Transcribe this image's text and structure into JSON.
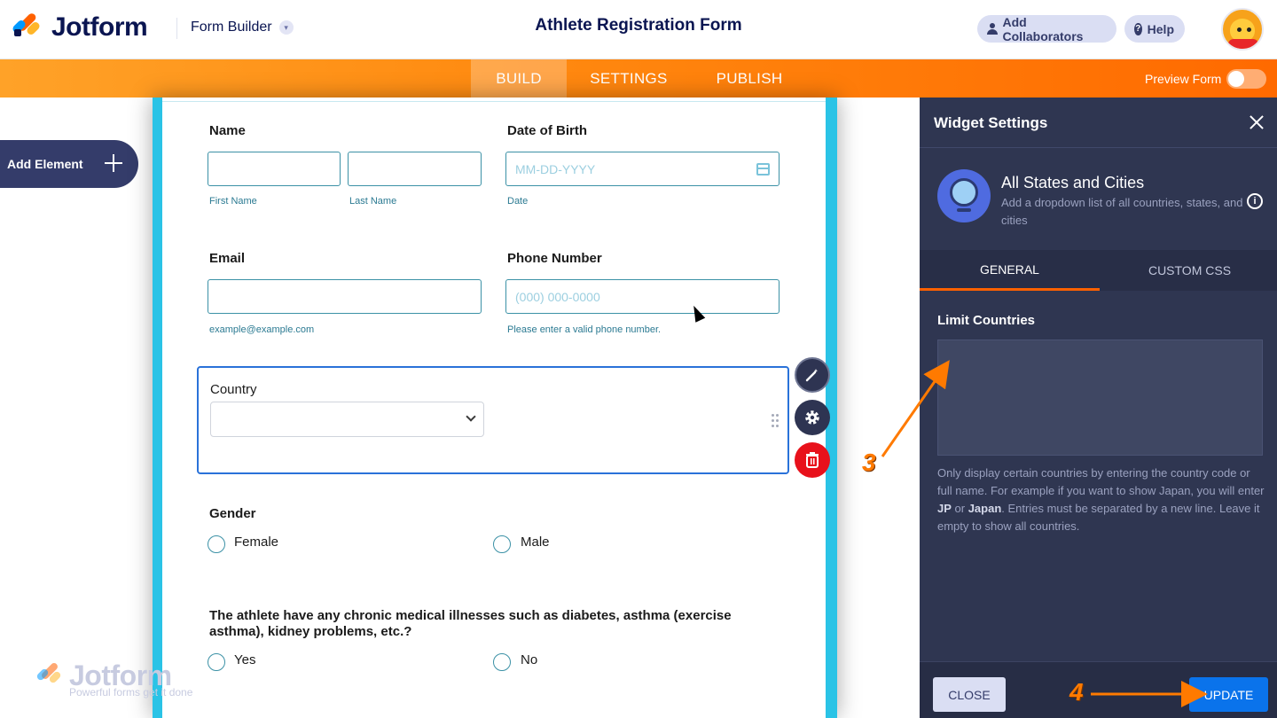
{
  "header": {
    "logo_text": "Jotform",
    "builder_label": "Form Builder",
    "form_title": "Athlete Registration Form",
    "add_collaborators": "Add Collaborators",
    "help": "Help"
  },
  "nav": {
    "tabs": [
      "BUILD",
      "SETTINGS",
      "PUBLISH"
    ],
    "active_tab": "BUILD",
    "preview_label": "Preview Form",
    "preview_enabled": false
  },
  "sidebar": {
    "add_element": "Add Element"
  },
  "form": {
    "name_label": "Name",
    "first_name_sub": "First Name",
    "last_name_sub": "Last Name",
    "dob_label": "Date of Birth",
    "dob_placeholder": "MM-DD-YYYY",
    "dob_sub": "Date",
    "email_label": "Email",
    "email_sub": "example@example.com",
    "phone_label": "Phone Number",
    "phone_placeholder": "(000) 000-0000",
    "phone_sub": "Please enter a valid phone number.",
    "country_label": "Country",
    "gender_label": "Gender",
    "gender_options": [
      "Female",
      "Male"
    ],
    "question": "The athlete have any chronic medical illnesses such as diabetes, asthma (exercise asthma), kidney problems, etc.?",
    "question_options": [
      "Yes",
      "No"
    ]
  },
  "watermark": {
    "text": "Jotform",
    "tagline": "Powerful forms get it done"
  },
  "panel": {
    "title": "Widget Settings",
    "widget_name": "All States and Cities",
    "widget_desc": "Add a dropdown list of all countries, states, and cities",
    "tabs": [
      "GENERAL",
      "CUSTOM CSS"
    ],
    "active_tab": "GENERAL",
    "field_label": "Limit Countries",
    "field_value": "",
    "help_part1": "Only display certain countries by entering the country code or full name. For example if you want to show Japan, you will enter ",
    "help_bold1": "JP",
    "help_or": " or ",
    "help_bold2": "Japan",
    "help_part2": ". Entries must be separated by a new line. Leave it empty to show all countries.",
    "close_button": "CLOSE",
    "update_button": "UPDATE"
  },
  "annotations": {
    "step3": "3",
    "step4": "4",
    "color": "#ff7a00"
  }
}
